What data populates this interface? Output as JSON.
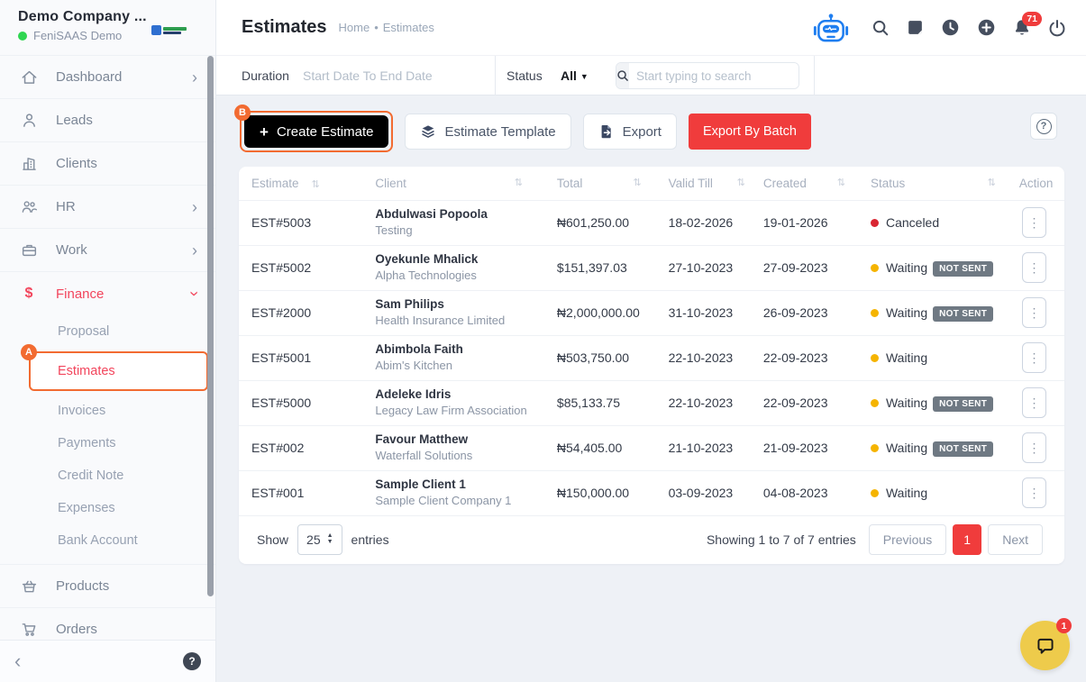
{
  "annotations": {
    "a": "A",
    "b": "B"
  },
  "sidebar": {
    "company_name": "Demo Company ...",
    "workspace": "FeniSAAS Demo",
    "main_items": [
      {
        "label": "Dashboard",
        "icon": "home-icon"
      },
      {
        "label": "Leads",
        "icon": "person-icon"
      },
      {
        "label": "Clients",
        "icon": "building-icon"
      },
      {
        "label": "HR",
        "icon": "people-icon"
      },
      {
        "label": "Work",
        "icon": "briefcase-icon"
      },
      {
        "label": "Finance",
        "icon": "dollar-icon"
      }
    ],
    "finance_submenu": [
      {
        "label": "Proposal"
      },
      {
        "label": "Estimates",
        "active": true
      },
      {
        "label": "Invoices"
      },
      {
        "label": "Payments"
      },
      {
        "label": "Credit Note"
      },
      {
        "label": "Expenses"
      },
      {
        "label": "Bank Account"
      }
    ],
    "bottom_items": [
      {
        "label": "Products",
        "icon": "basket-icon"
      },
      {
        "label": "Orders",
        "icon": "cart-icon"
      }
    ],
    "help_glyph": "?"
  },
  "header": {
    "title": "Estimates",
    "breadcrumb": {
      "home": "Home",
      "separator": "•",
      "current": "Estimates"
    },
    "notification_count": "71"
  },
  "filters": {
    "duration_label": "Duration",
    "duration_placeholder": "Start Date To End Date",
    "status_label": "Status",
    "status_value": "All",
    "search_placeholder": "Start typing to search"
  },
  "toolbar": {
    "create_label": "Create Estimate",
    "template_label": "Estimate Template",
    "export_label": "Export",
    "export_batch_label": "Export By Batch"
  },
  "table": {
    "headers": [
      "Estimate",
      "Client",
      "Total",
      "Valid Till",
      "Created",
      "Status",
      "Action"
    ],
    "sort_glyph": "⇅",
    "rows": [
      {
        "estimate": "EST#5003",
        "client_name": "Abdulwasi Popoola",
        "client_company": "Testing",
        "total": "₦601,250.00",
        "valid_till": "18-02-2026",
        "created": "19-01-2026",
        "status": "Canceled",
        "status_color": "#d92632",
        "badge": ""
      },
      {
        "estimate": "EST#5002",
        "client_name": "Oyekunle Mhalick",
        "client_company": "Alpha Technologies",
        "total": "$151,397.03",
        "valid_till": "27-10-2023",
        "created": "27-09-2023",
        "status": "Waiting",
        "status_color": "#f5b400",
        "badge": "NOT SENT"
      },
      {
        "estimate": "EST#2000",
        "client_name": "Sam Philips",
        "client_company": "Health Insurance Limited",
        "total": "₦2,000,000.00",
        "valid_till": "31-10-2023",
        "created": "26-09-2023",
        "status": "Waiting",
        "status_color": "#f5b400",
        "badge": "NOT SENT"
      },
      {
        "estimate": "EST#5001",
        "client_name": "Abimbola Faith",
        "client_company": "Abim's Kitchen",
        "total": "₦503,750.00",
        "valid_till": "22-10-2023",
        "created": "22-09-2023",
        "status": "Waiting",
        "status_color": "#f5b400",
        "badge": ""
      },
      {
        "estimate": "EST#5000",
        "client_name": "Adeleke Idris",
        "client_company": "Legacy Law Firm Association",
        "total": "$85,133.75",
        "valid_till": "22-10-2023",
        "created": "22-09-2023",
        "status": "Waiting",
        "status_color": "#f5b400",
        "badge": "NOT SENT"
      },
      {
        "estimate": "EST#002",
        "client_name": "Favour Matthew",
        "client_company": "Waterfall Solutions",
        "total": "₦54,405.00",
        "valid_till": "21-10-2023",
        "created": "21-09-2023",
        "status": "Waiting",
        "status_color": "#f5b400",
        "badge": "NOT SENT"
      },
      {
        "estimate": "EST#001",
        "client_name": "Sample Client 1",
        "client_company": "Sample Client Company 1",
        "total": "₦150,000.00",
        "valid_till": "03-09-2023",
        "created": "04-08-2023",
        "status": "Waiting",
        "status_color": "#f5b400",
        "badge": ""
      }
    ]
  },
  "pagination": {
    "show_label": "Show",
    "page_size": "25",
    "entries_label": "entries",
    "summary": "Showing 1 to 7 of 7 entries",
    "previous_label": "Previous",
    "current_page": "1",
    "next_label": "Next"
  },
  "chat": {
    "unread_count": "1"
  },
  "icons": {
    "topbar": [
      "ai-robot-icon",
      "search-icon",
      "feedback-note-icon",
      "history-clock-icon",
      "quick-add-plus-icon",
      "notifications-bell-icon",
      "logout-power-icon"
    ],
    "status_dot": "filled-circle",
    "row_action": "kebab-menu-icon"
  },
  "colors": {
    "accent_red": "#f03c3c",
    "sidebar_active_red": "#f2455c",
    "annotation_orange": "#f26b31",
    "status_waiting": "#f5b400",
    "status_canceled": "#d92632",
    "robot_blue": "#1f7ef0",
    "chat_yellow": "#eecb4b",
    "online_green": "#2fd651",
    "not_sent_badge": "#6f7983"
  }
}
